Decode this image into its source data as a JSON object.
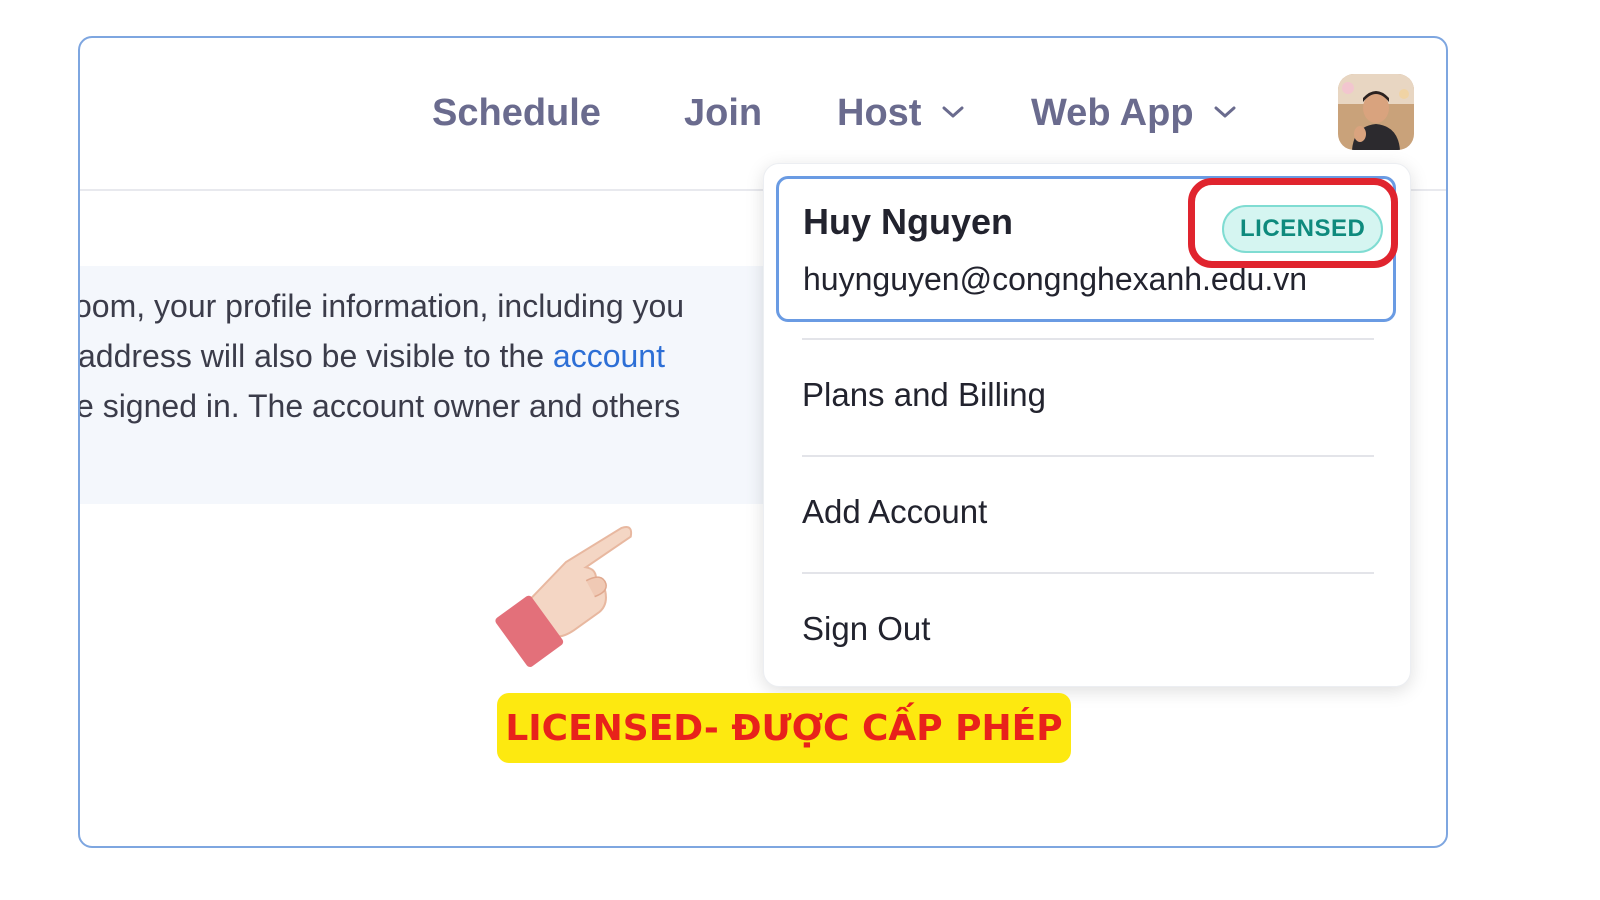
{
  "topnav": {
    "items": [
      {
        "label": "Schedule",
        "has_dropdown": false
      },
      {
        "label": "Join",
        "has_dropdown": false
      },
      {
        "label": "Host",
        "has_dropdown": true
      },
      {
        "label": "Web App",
        "has_dropdown": true
      }
    ]
  },
  "avatar": {
    "icon": "user-avatar-photo"
  },
  "info_panel": {
    "lines": [
      "oom, your profile information, including you",
      "address will also be visible to the ",
      "e signed in. The account owner and others"
    ],
    "link_text": "account"
  },
  "profile_menu": {
    "name": "Huy Nguyen",
    "email": "huynguyen@congnghexanh.edu.vn",
    "badge": "LICENSED",
    "items": [
      "Plans and Billing",
      "Add Account",
      "Sign Out"
    ]
  },
  "annotation": {
    "callout_text": "LICENSED- ĐƯỢC CẤP PHÉP",
    "highlight_color": "#e0242e",
    "callout_bg": "#fde910",
    "pointer_icon": "pointing-hand-icon"
  },
  "colors": {
    "nav_text": "#6a6b8e",
    "link": "#2d6fd6",
    "badge_bg": "#d5f5f1",
    "badge_text": "#0e8a7d",
    "profile_border": "#6a9be3"
  }
}
